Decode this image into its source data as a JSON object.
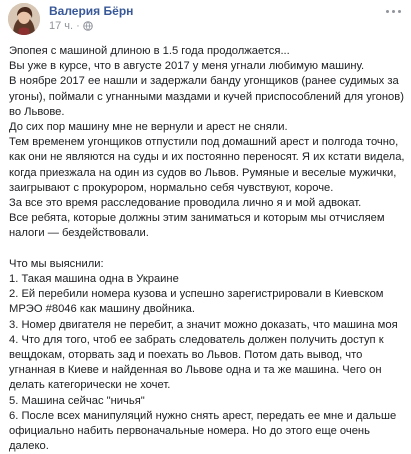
{
  "post": {
    "author": "Валерия Бёрн",
    "time": "17 ч.",
    "time_separator": "·",
    "privacy_icon": "globe-icon",
    "menu_icon": "more-options-icon",
    "paragraphs_top": [
      "Эпопея с машиной длиною в 1.5 года продолжается...",
      "Вы уже в курсе, что в августе 2017 у меня угнали любимую машину.",
      "В ноябре 2017 ее нашли и задержали банду угонщиков (ранее судимых за угоны), поймали с угнанными маздами и кучей приспособлений для угонов) во Львове.",
      "До сих пор машину мне не вернули и арест не сняли.",
      "Тем временем угонщиков отпустили под домашний арест и полгода точно, как они не являются на суды и их постоянно переносят. Я их кстати видела, когда приезжала на один из судов во Львов. Румяные и веселые мужички, заигрывают с прокурором, нормально себя чувствуют, короче.",
      "За все это время расследование проводила лично я и мой адвокат.",
      "Все ребята, которые должны этим заниматься и которым мы отчисляем налоги — бездействовали."
    ],
    "list_heading": "Что мы выяснили:",
    "list_items": [
      "1. Такая машина одна в Украине",
      "2. Ей перебили номера кузова и успешно зарегистрировали в Киевском МРЭО #8046 как машину двойника.",
      "3. Номер двигателя не перебит, а значит можно доказать, что машина моя",
      "4. Что для того, чтоб ее забрать следователь должен получить доступ к вещдокам, оторвать зад и поехать во Львов. Потом дать вывод, что угнанная в Киеве и найденная во Львове одна и та же машина. Чего он делать категорически не хочет.",
      "5. Машина сейчас \"ничья\"",
      "6. После всех манипуляций нужно снять арест, передать ее мне и дальше официально набить первоначальные номера. Но до этого еще очень далеко."
    ]
  }
}
